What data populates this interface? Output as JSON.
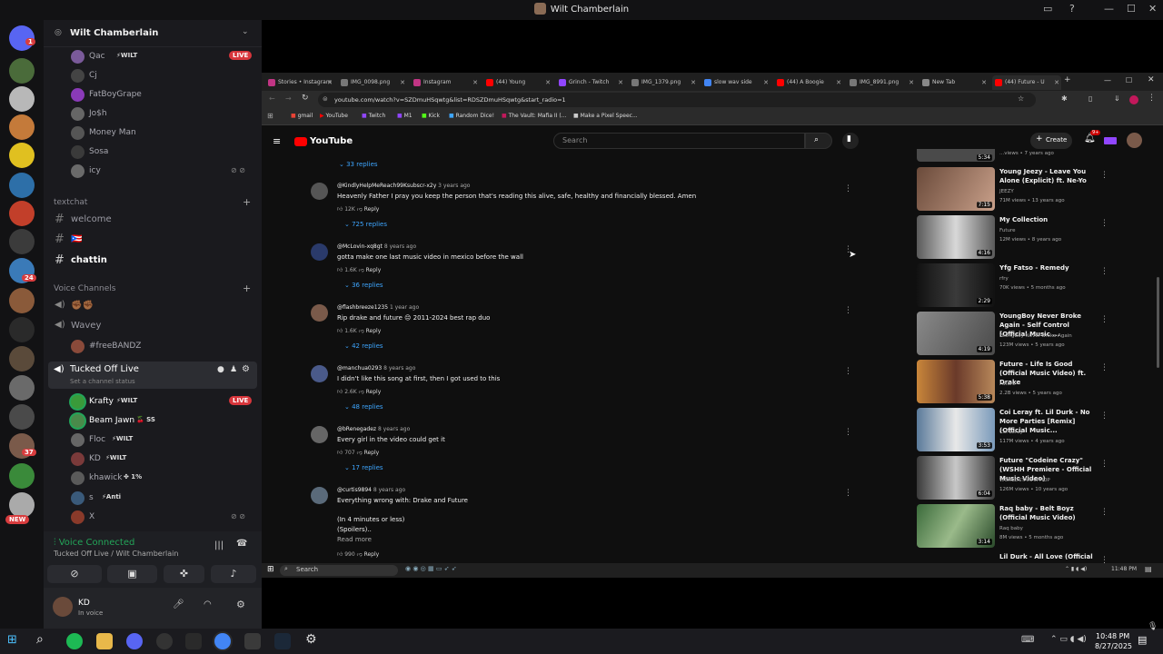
{
  "window": {
    "title": "Wilt Chamberlain"
  },
  "discord": {
    "server_name": "Wilt Chamberlain",
    "server_badges": [
      {
        "count": "1"
      },
      {
        "count": "24"
      },
      {
        "count": "37"
      },
      {
        "count": "NEW"
      }
    ],
    "top_users": [
      {
        "name": "Qac",
        "tag": "⚡WILT",
        "live": "LIVE"
      },
      {
        "name": "Cj",
        "tag": ""
      },
      {
        "name": "FatBoyGrape",
        "tag": ""
      },
      {
        "name": "Jo$h",
        "tag": ""
      },
      {
        "name": "Money Man",
        "tag": ""
      },
      {
        "name": "Sosa",
        "tag": ""
      },
      {
        "name": "icy",
        "tag": ""
      }
    ],
    "textchat_label": "textchat",
    "text_channels": [
      "welcome",
      "🇵🇷",
      "chattin"
    ],
    "voice_label": "Voice Channels",
    "voice_channels": [
      "✊🏾✊🏾",
      "Wavey",
      "#freeBANDZ"
    ],
    "active_channel": {
      "name": "Tucked Off Live",
      "status": "Set a channel status"
    },
    "active_users": [
      {
        "name": "Krafty",
        "tag": "⚡WILT",
        "live": "LIVE"
      },
      {
        "name": "Beam Jawn",
        "tag": "🍒 SS"
      },
      {
        "name": "Floc",
        "tag": "⚡WILT"
      },
      {
        "name": "KD",
        "tag": "⚡WILT"
      },
      {
        "name": "khawick",
        "tag": "✤ 1%"
      },
      {
        "name": "s",
        "tag": "⚡Anti"
      },
      {
        "name": "X",
        "tag": ""
      }
    ],
    "voice_panel": {
      "status": "Voice Connected",
      "location": "Tucked Off Live / Wilt Chamberlain"
    },
    "user": {
      "name": "KD",
      "status": "In voice"
    }
  },
  "browser": {
    "tabs": [
      {
        "label": "Stories • Instagram",
        "color": "#c13584"
      },
      {
        "label": "IMG_0098.png",
        "color": "#777"
      },
      {
        "label": "Instagram",
        "color": "#c13584"
      },
      {
        "label": "(44) Young",
        "color": "#ff0000"
      },
      {
        "label": "Grinch - Twitch",
        "color": "#9146ff"
      },
      {
        "label": "IMG_1379.png",
        "color": "#777"
      },
      {
        "label": "slow wav side",
        "color": "#4285f4"
      },
      {
        "label": "(44) A Boogie",
        "color": "#ff0000"
      },
      {
        "label": "IMG_8991.png",
        "color": "#777"
      },
      {
        "label": "New Tab",
        "color": "#888"
      },
      {
        "label": "(44) Future - U",
        "color": "#ff0000"
      }
    ],
    "url": "youtube.com/watch?v=SZDmuHSqwtg&list=RDSZDmuHSqwtg&start_radio=1",
    "bookmarks": [
      "gmail",
      "YouTube",
      "Twitch",
      "M1",
      "Kick",
      "Random Dice!",
      "The Vault: Mafia II (...",
      "Make a Pixel Speec..."
    ]
  },
  "youtube": {
    "logo": "YouTube",
    "search_placeholder": "Search",
    "create_label": "Create",
    "notif_count": "9+",
    "comments": [
      {
        "handle": "",
        "time": "",
        "text": "",
        "likes": "",
        "replies": "33 replies"
      },
      {
        "handle": "@KindlyHelpMeReach99Ksubscr-x2y",
        "time": "3 years ago",
        "text": "Heavenly Father I pray you keep the person that's reading this alive, safe, healthy and financially blessed. Amen",
        "likes": "12K",
        "replies": "725 replies"
      },
      {
        "handle": "@McLovin-xq8gt",
        "time": "8 years ago",
        "text": "gotta make one last music video in mexico before the wall",
        "likes": "1.6K",
        "replies": "36 replies"
      },
      {
        "handle": "@flashbreeze1235",
        "time": "1 year ago",
        "text": "Rip drake and future 😔 2011-2024 best rap duo",
        "likes": "1.6K",
        "replies": "42 replies"
      },
      {
        "handle": "@manchua0293",
        "time": "8 years ago",
        "text": "I didn't like this song at first, then I got used to this",
        "likes": "2.6K",
        "replies": "48 replies"
      },
      {
        "handle": "@bRenegadez",
        "time": "8 years ago",
        "text": "Every girl in the video could get it",
        "likes": "707",
        "replies": "17 replies"
      },
      {
        "handle": "@curtis9894",
        "time": "8 years ago",
        "text": "Everything wrong with: Drake and Future",
        "likes": "990",
        "replies": ""
      }
    ],
    "extra_comment_lines": [
      "(In 4 minutes or less)",
      "(Spoilers)..",
      "Read more"
    ],
    "reply_label": "Reply",
    "videos": [
      {
        "title": "",
        "channel": "",
        "meta": "...views • 7 years ago",
        "duration": "5:34"
      },
      {
        "title": "Young Jeezy - Leave You Alone (Explicit) ft. Ne-Yo",
        "channel": "JEEZY",
        "meta": "71M views • 13 years ago",
        "duration": "7:15"
      },
      {
        "title": "My Collection",
        "channel": "Future",
        "meta": "12M views • 8 years ago",
        "duration": "4:16"
      },
      {
        "title": "Yfg Fatso - Remedy",
        "channel": "rfry",
        "meta": "70K views • 5 months ago",
        "duration": "2:29"
      },
      {
        "title": "YoungBoy Never Broke Again - Self Control [Official Music ...",
        "channel": "YoungBoy Never Broke Again",
        "meta": "123M views • 5 years ago",
        "duration": "4:19"
      },
      {
        "title": "Future - Life Is Good (Official Music Video) ft. Drake",
        "channel": "Future",
        "meta": "2.2B views • 5 years ago",
        "duration": "5:38"
      },
      {
        "title": "Coi Leray ft. Lil Durk - No More Parties [Remix] (Official Music...",
        "channel": "Coi Leray",
        "meta": "117M views • 4 years ago",
        "duration": "3:53"
      },
      {
        "title": "Future \"Codeine Crazy\" (WSHH Premiere - Official Music Video)",
        "channel": "WORLDSTARHIPHOP",
        "meta": "126M views • 10 years ago",
        "duration": "6:04"
      },
      {
        "title": "Raq baby - Belt Boyz (Official Music Video)",
        "channel": "Raq baby",
        "meta": "8M views • 5 months ago",
        "duration": "3:14"
      },
      {
        "title": "Lil Durk - All Love (Official",
        "channel": "",
        "meta": "",
        "duration": ""
      }
    ]
  },
  "inner_taskbar": {
    "search": "Search",
    "time": "11:48 PM"
  },
  "taskbar": {
    "time": "10:48 PM",
    "date": "8/27/2025"
  }
}
